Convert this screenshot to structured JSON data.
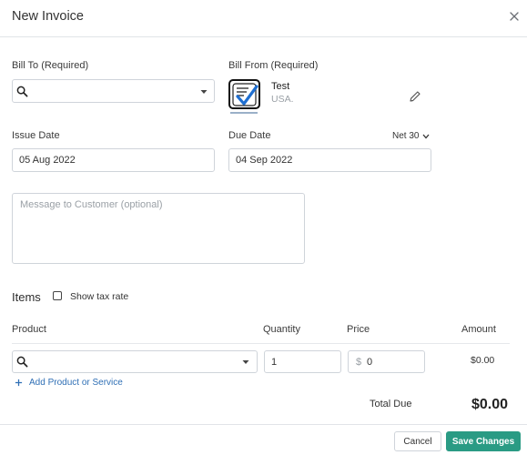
{
  "modal": {
    "title": "New Invoice"
  },
  "bill_to": {
    "label": "Bill To (Required)",
    "value": ""
  },
  "bill_from": {
    "label": "Bill From (Required)",
    "name": "Test",
    "country": "USA."
  },
  "issue_date": {
    "label": "Issue Date",
    "value": "05 Aug 2022"
  },
  "due_date": {
    "label": "Due Date",
    "value": "04 Sep 2022",
    "terms": "Net 30"
  },
  "message": {
    "placeholder": "Message to Customer (optional)"
  },
  "items": {
    "heading": "Items",
    "show_tax_label": "Show tax rate",
    "show_tax_checked": false,
    "columns": {
      "product": "Product",
      "quantity": "Quantity",
      "price": "Price",
      "amount": "Amount"
    },
    "row": {
      "product": "",
      "quantity": "1",
      "currency": "$",
      "price": "0",
      "amount": "$0.00"
    },
    "add_label": "Add Product or Service",
    "total_label": "Total Due",
    "total_value": "$0.00"
  },
  "footer": {
    "cancel_label": "Cancel",
    "save_label": "Save Changes"
  },
  "colors": {
    "accent": "#2a9b84",
    "link": "#2f6fb5",
    "logo_blue": "#1f6fd1"
  },
  "icons": [
    "close-icon",
    "search-icon",
    "chevron-down-icon",
    "edit-pencil-icon",
    "plus-icon",
    "company-logo"
  ]
}
